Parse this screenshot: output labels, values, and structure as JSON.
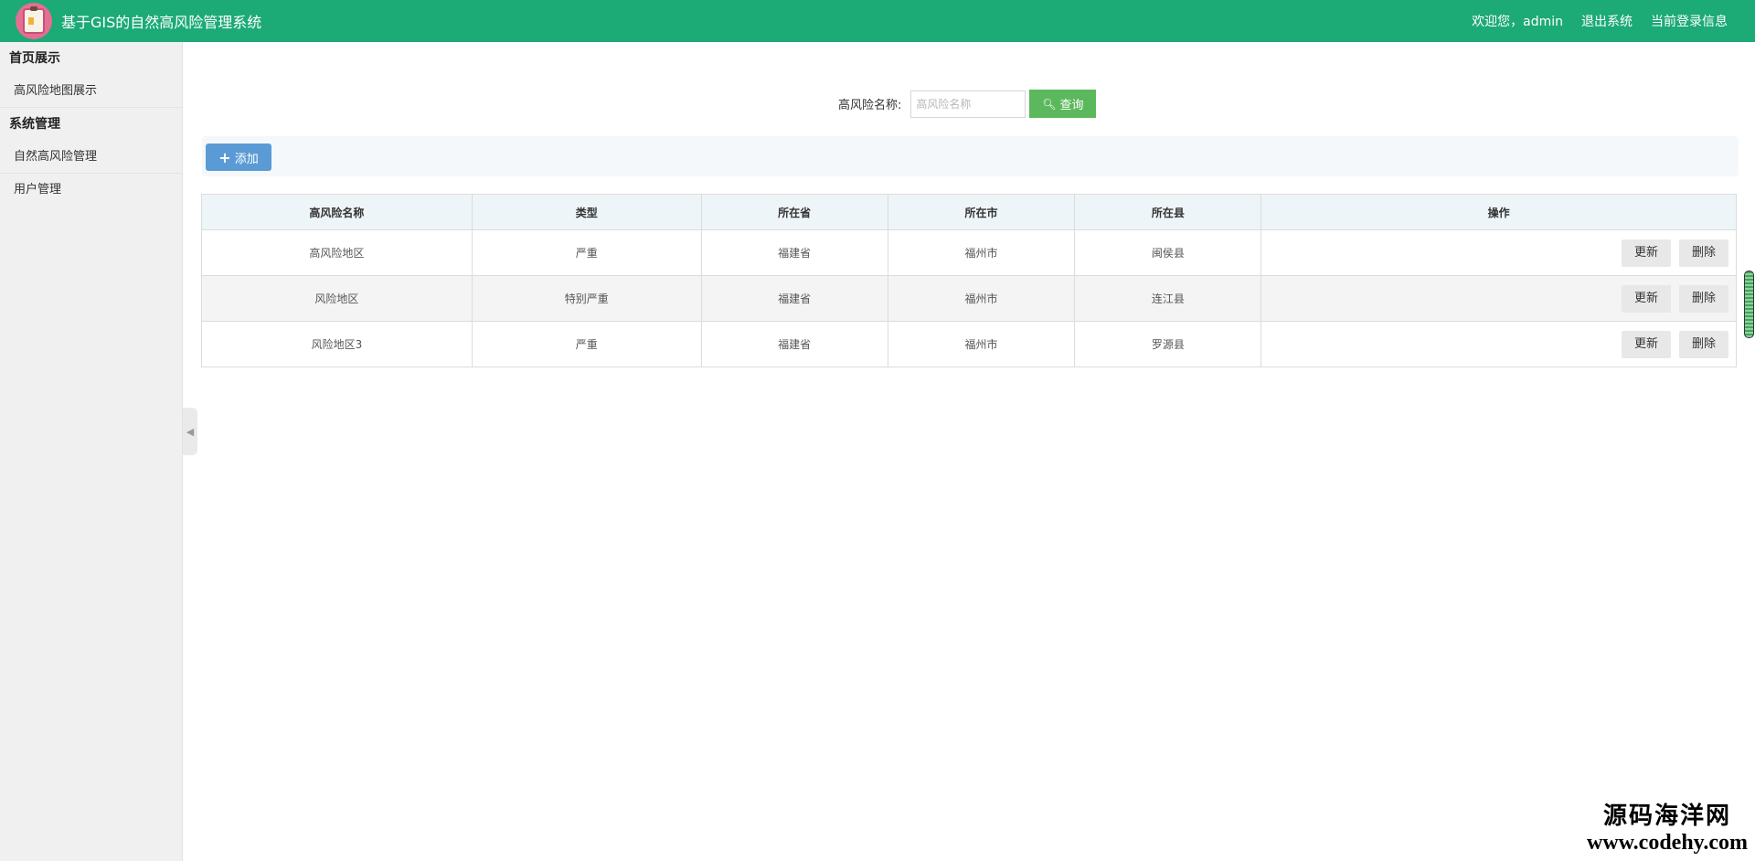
{
  "header": {
    "app_title": "基于GIS的自然高风险管理系统",
    "welcome": "欢迎您，admin",
    "logout": "退出系统",
    "current_login_info": "当前登录信息",
    "logo_icon": "clipboard-icon",
    "background_color": "#1caa77"
  },
  "sidebar": {
    "groups": [
      {
        "title": "首页展示",
        "items": [
          {
            "label": "高风险地图展示"
          }
        ]
      },
      {
        "title": "系统管理",
        "items": [
          {
            "label": "自然高风险管理"
          },
          {
            "label": "用户管理"
          }
        ]
      }
    ]
  },
  "search": {
    "label": "高风险名称:",
    "placeholder": "高风险名称",
    "value": "",
    "button_label": "查询",
    "button_icon": "search-icon"
  },
  "toolbar": {
    "add_label": "添加",
    "add_icon": "plus-icon"
  },
  "table": {
    "columns": [
      "高风险名称",
      "类型",
      "所在省",
      "所在市",
      "所在县",
      "操作"
    ],
    "rows": [
      {
        "name": "高风险地区",
        "type": "严重",
        "province": "福建省",
        "city": "福州市",
        "county": "闽侯县",
        "update": "更新",
        "delete": "删除"
      },
      {
        "name": "风险地区",
        "type": "特别严重",
        "province": "福建省",
        "city": "福州市",
        "county": "连江县",
        "update": "更新",
        "delete": "删除"
      },
      {
        "name": "风险地区3",
        "type": "严重",
        "province": "福建省",
        "city": "福州市",
        "county": "罗源县",
        "update": "更新",
        "delete": "删除"
      }
    ]
  },
  "watermark": {
    "line1": "源码海洋网",
    "line2": "www.codehy.com"
  }
}
